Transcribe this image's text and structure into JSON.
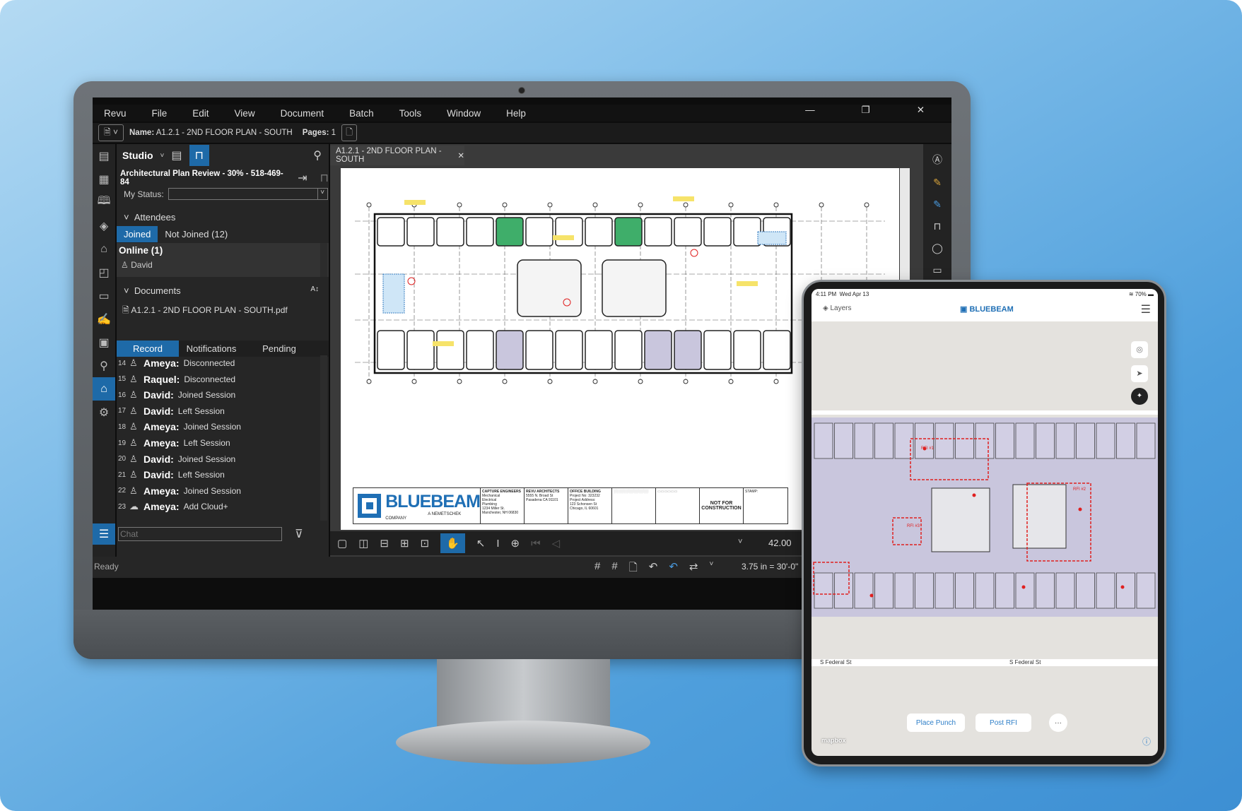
{
  "menu": [
    "Revu",
    "File",
    "Edit",
    "View",
    "Document",
    "Batch",
    "Tools",
    "Window",
    "Help"
  ],
  "window_controls": {
    "minimize": "—",
    "restore": "❐",
    "close": "✕"
  },
  "docbar": {
    "name_label": "Name:",
    "name_value": "A1.2.1 - 2ND FLOOR PLAN - SOUTH",
    "pages_label": "Pages:",
    "pages_value": "1"
  },
  "studio": {
    "title": "Studio",
    "session": "Architectural Plan Review - 30% - 518-469-84",
    "status_label": "My Status:",
    "status_value": "",
    "attendees_heading": "Attendees",
    "tabs": [
      "Joined",
      "Not Joined (12)"
    ],
    "online": "Online (1)",
    "online_users": [
      "David"
    ],
    "documents_heading": "Documents",
    "sort_icon": "A-Z",
    "documents": [
      "A1.2.1 - 2ND FLOOR PLAN - SOUTH.pdf"
    ],
    "record_tabs": [
      "Record",
      "Notifications",
      "Pending"
    ],
    "record": [
      {
        "n": "14",
        "user": "Ameya:",
        "action": "Disconnected",
        "icon": "person-icon"
      },
      {
        "n": "15",
        "user": "Raquel:",
        "action": "Disconnected",
        "icon": "person-icon"
      },
      {
        "n": "16",
        "user": "David:",
        "action": "Joined Session",
        "icon": "person-icon"
      },
      {
        "n": "17",
        "user": "David:",
        "action": "Left Session",
        "icon": "person-icon"
      },
      {
        "n": "18",
        "user": "Ameya:",
        "action": "Joined Session",
        "icon": "person-icon"
      },
      {
        "n": "19",
        "user": "Ameya:",
        "action": "Left Session",
        "icon": "person-icon"
      },
      {
        "n": "20",
        "user": "David:",
        "action": "Joined Session",
        "icon": "person-icon"
      },
      {
        "n": "21",
        "user": "David:",
        "action": "Left Session",
        "icon": "person-icon"
      },
      {
        "n": "22",
        "user": "Ameya:",
        "action": "Joined Session",
        "icon": "person-icon"
      },
      {
        "n": "23",
        "user": "Ameya:",
        "action": "Add Cloud+",
        "icon": "cloud-markup-icon"
      }
    ],
    "chat_placeholder": "Chat"
  },
  "status": {
    "ready": "Ready",
    "scale": "3.75 in = 30'-0\"",
    "zoom": "42.00"
  },
  "doc_tab": "A1.2.1 - 2ND FLOOR PLAN - SOUTH",
  "title_block": {
    "logo": "BLUEBEAM",
    "logo_sub": "A NEMETSCHEK COMPANY",
    "engineer": [
      "CAPTURE ENGINEERS",
      "Mechanical",
      "Electrical",
      "Plumbing",
      "1234 Miller St.",
      "Manchester, NH 06830"
    ],
    "architect": [
      "REVU ARCHITECTS",
      "5555 N. Broad St",
      "Pasadena CA 91101"
    ],
    "project": [
      "OFFICE BUILDING",
      "Project No: 323232",
      "Project Address:",
      "123 Schonsen St",
      "Chicago, IL 60601"
    ],
    "stamp_note": "NOT FOR CONSTRUCTION",
    "stamp": "STAMP:"
  },
  "tablet": {
    "time": "4:11 PM",
    "date": "Wed Apr 13",
    "battery": "70%",
    "layers": "Layers",
    "logo": "BLUEBEAM",
    "street": "S Federal St",
    "buttons": [
      "Place Punch",
      "Post RFI"
    ],
    "more": "···",
    "attribution": "mapbox",
    "rfi_labels": [
      "RFI #1",
      "RFI #2",
      "RFI #3"
    ]
  },
  "colors": {
    "accent": "#1e6aa8",
    "brand": "#1f6fb5",
    "markup_red": "#e02020",
    "plan_purple": "#c9c6dd",
    "highlight_green": "#3fae6a"
  }
}
